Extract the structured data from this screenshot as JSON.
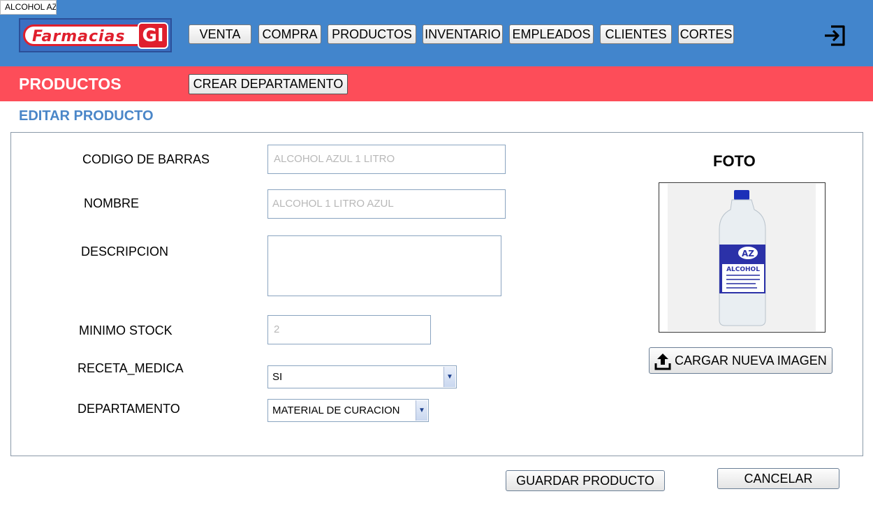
{
  "window": {
    "tab_title": "ALCOHOL AZ"
  },
  "header": {
    "logo_text": "Farmacias",
    "logo_badge": "GI",
    "nav": [
      {
        "label": "VENTA"
      },
      {
        "label": "COMPRA"
      },
      {
        "label": "PRODUCTOS"
      },
      {
        "label": "INVENTARIO"
      },
      {
        "label": "EMPLEADOS"
      },
      {
        "label": "CLIENTES"
      },
      {
        "label": "CORTES"
      }
    ],
    "exit_icon": "logout-icon"
  },
  "section": {
    "title": "PRODUCTOS",
    "create_department_label": "CREAR DEPARTAMENTO"
  },
  "form": {
    "subtitle": "EDITAR PRODUCTO",
    "barcode_label": "CODIGO DE BARRAS",
    "barcode_value": "ALCOHOL AZUL 1 LITRO",
    "name_label": "NOMBRE",
    "name_value": "ALCOHOL 1 LITRO AZUL",
    "description_label": "DESCRIPCION",
    "description_value": "",
    "min_stock_label": "MINIMO STOCK",
    "min_stock_value": "2",
    "prescription_label": "RECETA_MEDICA",
    "prescription_value": "SI",
    "department_label": "DEPARTAMENTO",
    "department_value": "MATERIAL DE CURACION"
  },
  "photo": {
    "title": "FOTO",
    "bottle_label": "ALCOHOL",
    "bottle_brand": "AZ",
    "upload_label": "CARGAR NUEVA IMAGEN"
  },
  "actions": {
    "save_label": "GUARDAR PRODUCTO",
    "cancel_label": "CANCELAR"
  },
  "colors": {
    "topbar": "#4285cc",
    "redbar": "#fd4d59",
    "subtitle": "#4a86c8"
  }
}
